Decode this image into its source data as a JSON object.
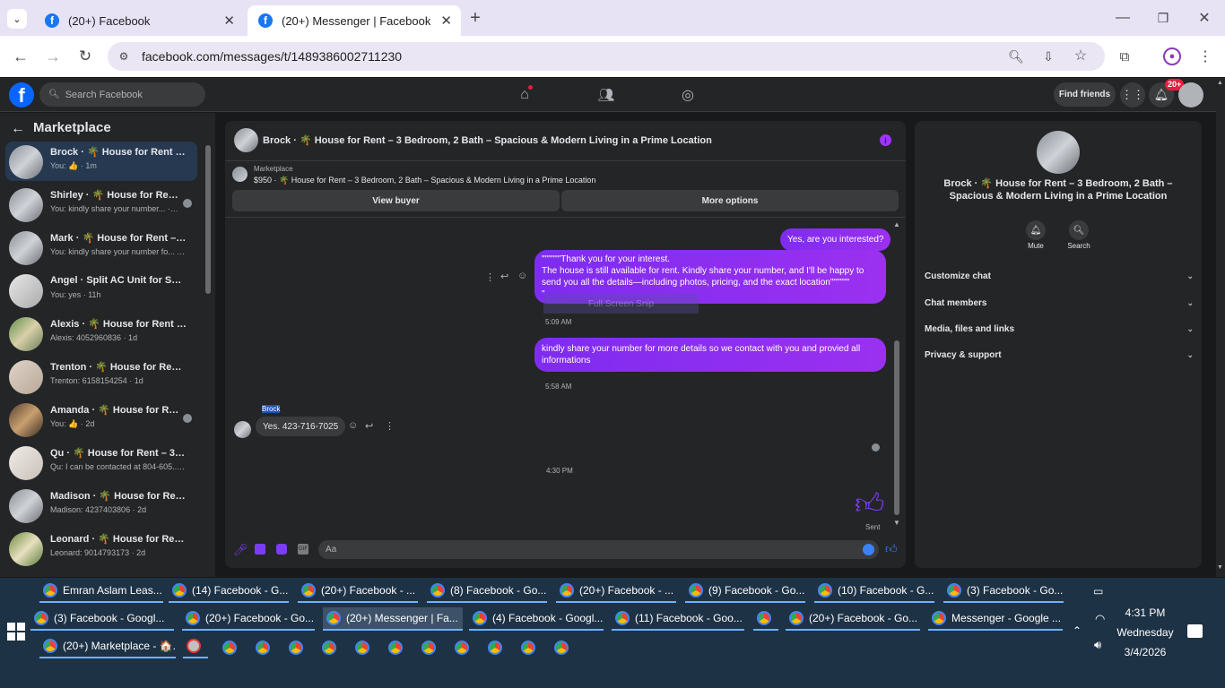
{
  "browser": {
    "tabs": [
      {
        "title": "(20+) Facebook",
        "active": false
      },
      {
        "title": "(20+) Messenger | Facebook",
        "active": true
      }
    ],
    "url": "facebook.com/messages/t/1489386002711230"
  },
  "fb": {
    "search_placeholder": "Search Facebook",
    "find_friends": "Find friends",
    "notif_badge": "20+"
  },
  "sidebar": {
    "title": "Marketplace",
    "conversations": [
      {
        "name": "Brock · 🌴 House for Rent – 3 B...",
        "preview": "You: 👍 · 1m"
      },
      {
        "name": "Shirley · 🌴 House for Rent –...",
        "preview": "You: kindly share your number... · 11h"
      },
      {
        "name": "Mark · 🌴 House for Rent – 3 B...",
        "preview": "You: kindly share your number fo... · 11h"
      },
      {
        "name": "Angel · Split AC Unit for Sale & ...",
        "preview": "You: yes · 11h"
      },
      {
        "name": "Alexis · 🌴 House for Rent – 3 B...",
        "preview": "Alexis: 4052960836 · 1d"
      },
      {
        "name": "Trenton · 🌴 House for Rent – 3...",
        "preview": "Trenton: 6158154254 · 1d"
      },
      {
        "name": "Amanda · 🌴 House for Rent ...",
        "preview": "You: 👍 · 2d"
      },
      {
        "name": "Qu · 🌴 House for Rent – 3 Bed...",
        "preview": "Qu: I can be contacted at 804-605... · 2d"
      },
      {
        "name": "Madison · 🌴 House for Rent –...",
        "preview": "Madison: 4237403806 · 2d"
      },
      {
        "name": "Leonard · 🌴 House for Rent –...",
        "preview": "Leonard: 9014793173 · 2d"
      }
    ]
  },
  "chat": {
    "header_title": "Brock · 🌴 House for Rent – 3 Bedroom, 2 Bath – Spacious & Modern Living in a Prime Location",
    "listing_label": "Marketplace",
    "listing_line": "$950 · 🌴 House for Rent – 3 Bedroom, 2 Bath – Spacious & Modern Living in a Prime Location",
    "view_buyer": "View buyer",
    "more_options": "More options",
    "msg1": "Yes, are you interested?",
    "msg2_line1": "\"\"\"\"\"\"Thank you for your interest.",
    "msg2_line2": "The house is still available for rent. Kindly share your number, and I'll be happy to send you all the details—including photos, pricing, and the exact location\"\"\"\"\"\"",
    "msg2_line3": "\"",
    "overlay_text": "Full Screen Snip",
    "time1": "5:09 AM",
    "msg3": "kindly share your number for more details so  we contact with you and provied all informations",
    "time2": "5:58 AM",
    "sender_name": "Brock",
    "incoming_msg": "Yes. 423-716-7025",
    "time3": "4:30 PM",
    "sent_label": "Sent",
    "composer_placeholder": "Aa"
  },
  "info": {
    "title": "Brock · 🌴 House for Rent – 3 Bedroom, 2 Bath – Spacious & Modern Living in a Prime Location",
    "mute": "Mute",
    "search": "Search",
    "sections": [
      "Customize chat",
      "Chat members",
      "Media, files and links",
      "Privacy & support"
    ]
  },
  "taskbar": {
    "row1": [
      "Emran Aslam Leas...",
      "(14) Facebook - G...",
      "(20+) Facebook - ...",
      "(8) Facebook - Go...",
      "(20+) Facebook - ...",
      "(9) Facebook - Go...",
      "(10) Facebook - G...",
      "(3) Facebook - Go..."
    ],
    "row2": [
      "(3) Facebook - Googl...",
      "(20+) Facebook - Go...",
      "(20+) Messenger | Fa...",
      "(4) Facebook - Googl...",
      "(11) Facebook - Goo...",
      "",
      "(20+) Facebook - Go...",
      "Messenger - Google ..."
    ],
    "row3": [
      "(20+) Marketplace - 🏠..."
    ],
    "time": "4:31 PM",
    "day": "Wednesday",
    "date": "3/4/2026"
  }
}
